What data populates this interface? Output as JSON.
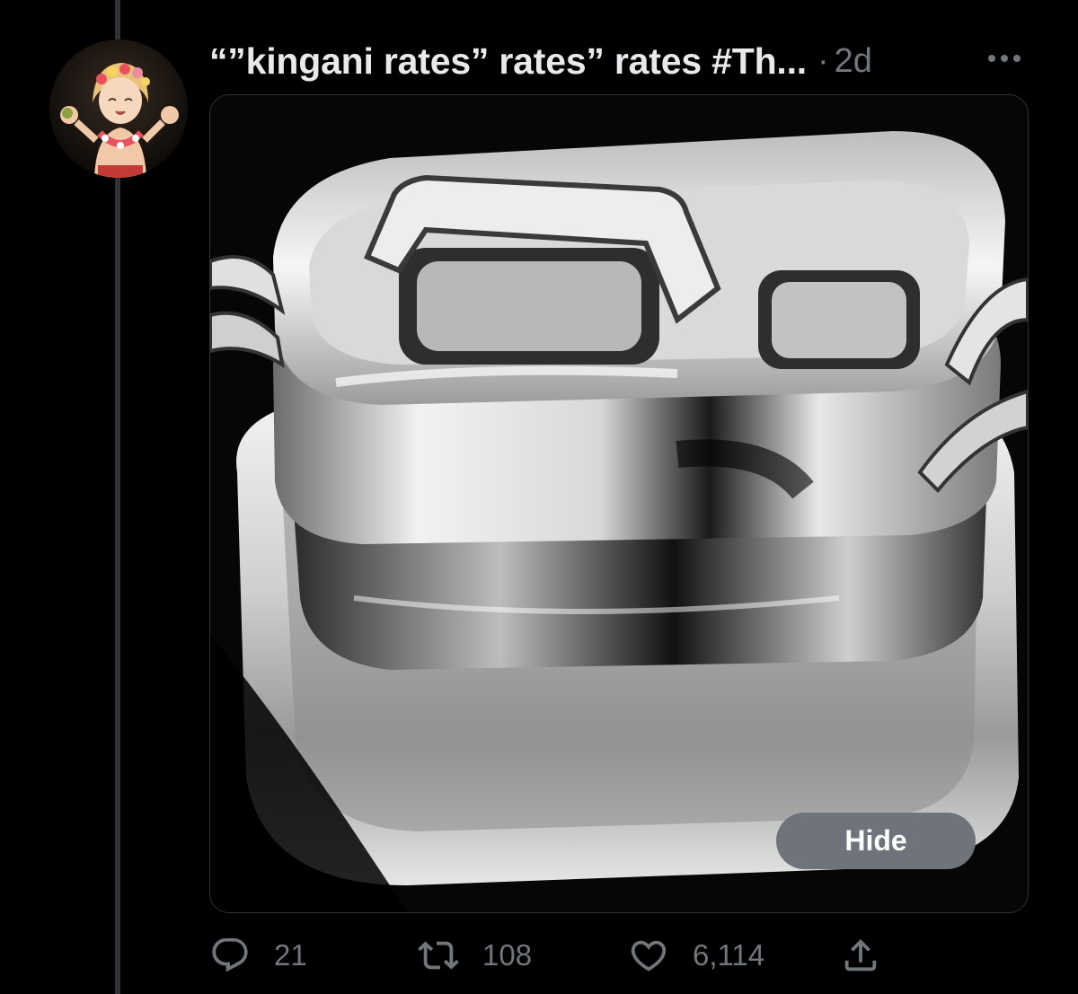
{
  "tweet": {
    "author_name": "“”kingani rates” rates” rates #Th...",
    "separator": "·",
    "timestamp": "2d",
    "media": {
      "hide_label": "Hide"
    },
    "actions": {
      "replies": "21",
      "retweets": "108",
      "likes": "6,114"
    }
  },
  "colors": {
    "background": "#000000",
    "primary_text": "#e7e9ea",
    "secondary_text": "#71767b",
    "hide_button": "#6e7479",
    "border": "#2f3336"
  },
  "icons": [
    "more-icon",
    "reply-icon",
    "retweet-icon",
    "like-icon",
    "share-icon"
  ]
}
